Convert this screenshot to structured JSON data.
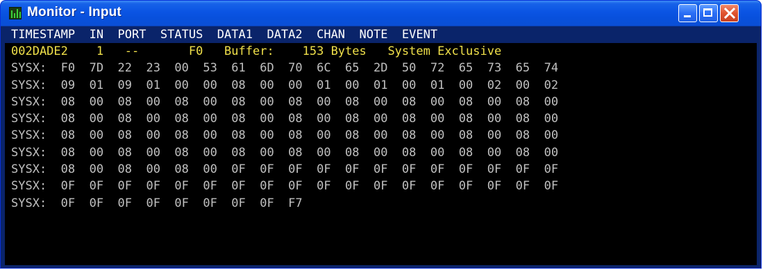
{
  "window": {
    "title": "Monitor - Input",
    "controls": {
      "minimize": "minimize",
      "maximize": "maximize",
      "close": "close"
    }
  },
  "monitor": {
    "header": "TIMESTAMP  IN  PORT  STATUS  DATA1  DATA2  CHAN  NOTE  EVENT",
    "event_row": "002DADE2    1   --       F0   Buffer:    153 Bytes   System Exclusive",
    "data_rows": [
      "SYSX:  F0  7D  22  23  00  53  61  6D  70  6C  65  2D  50  72  65  73  65  74",
      "SYSX:  09  01  09  01  00  00  08  00  00  01  00  01  00  01  00  02  00  02",
      "SYSX:  08  00  08  00  08  00  08  00  08  00  08  00  08  00  08  00  08  00",
      "SYSX:  08  00  08  00  08  00  08  00  08  00  08  00  08  00  08  00  08  00",
      "SYSX:  08  00  08  00  08  00  08  00  08  00  08  00  08  00  08  00  08  00",
      "SYSX:  08  00  08  00  08  00  08  00  08  00  08  00  08  00  08  00  08  00",
      "SYSX:  08  00  08  00  08  00  0F  0F  0F  0F  0F  0F  0F  0F  0F  0F  0F  0F",
      "SYSX:  0F  0F  0F  0F  0F  0F  0F  0F  0F  0F  0F  0F  0F  0F  0F  0F  0F  0F",
      "SYSX:  0F  0F  0F  0F  0F  0F  0F  0F  F7"
    ]
  },
  "colors": {
    "header_bg": "#0a246a",
    "event_text": "#f0e04a",
    "data_text": "#c0c0c0",
    "background": "#000000"
  }
}
